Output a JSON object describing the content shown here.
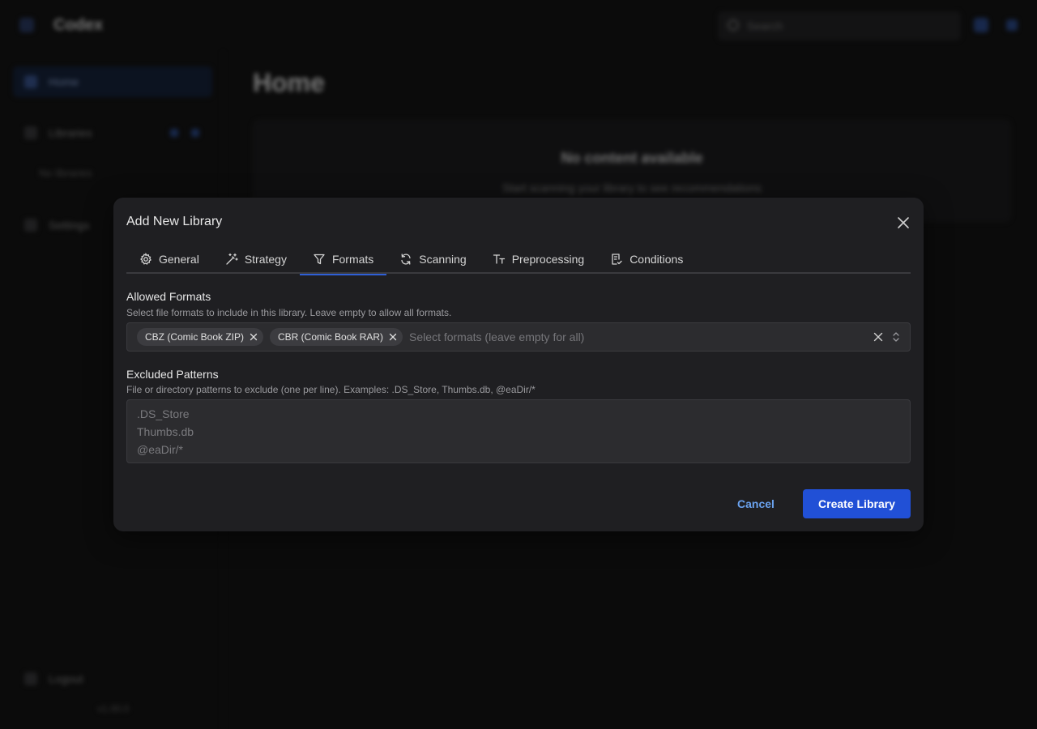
{
  "background": {
    "brand": "Codex",
    "search_placeholder": "Search",
    "nav": {
      "home": "Home",
      "libraries": "Libraries",
      "no_libraries": "No libraries",
      "settings": "Settings",
      "logout": "Logout"
    },
    "version": "v1.00.0",
    "page_title": "Home",
    "empty_title": "No content available",
    "empty_desc": "Start scanning your library to see recommendations"
  },
  "modal": {
    "title": "Add New Library",
    "tabs": [
      {
        "label": "General",
        "icon": "gear-icon",
        "active": false
      },
      {
        "label": "Strategy",
        "icon": "wand-icon",
        "active": false
      },
      {
        "label": "Formats",
        "icon": "filter-icon",
        "active": true
      },
      {
        "label": "Scanning",
        "icon": "refresh-icon",
        "active": false
      },
      {
        "label": "Preprocessing",
        "icon": "text-size-icon",
        "active": false
      },
      {
        "label": "Conditions",
        "icon": "checklist-icon",
        "active": false
      }
    ],
    "allowed_formats": {
      "label": "Allowed Formats",
      "description": "Select file formats to include in this library. Leave empty to allow all formats.",
      "selected": [
        "CBZ (Comic Book ZIP)",
        "CBR (Comic Book RAR)"
      ],
      "placeholder": "Select formats (leave empty for all)"
    },
    "excluded_patterns": {
      "label": "Excluded Patterns",
      "description": "File or directory patterns to exclude (one per line). Examples: .DS_Store, Thumbs.db, @eaDir/*",
      "lines": [
        ".DS_Store",
        "Thumbs.db",
        "@eaDir/*"
      ]
    },
    "cancel_label": "Cancel",
    "create_label": "Create Library"
  },
  "colors": {
    "accent": "#2150d6",
    "link": "#6aa2ee",
    "modal_bg": "#1f1f22"
  }
}
